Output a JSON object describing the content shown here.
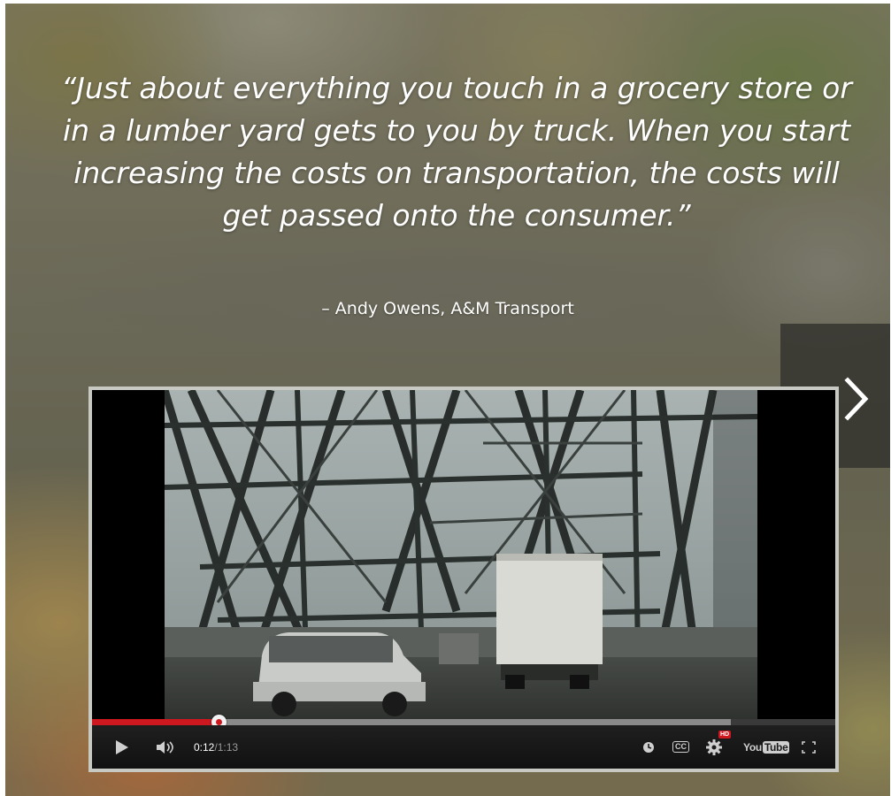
{
  "quote": {
    "text": "“Just about everything you touch in a grocery store or in a lumber yard gets to you by truck. When you start increasing the costs on transportation, the costs will get passed onto the consumer.”",
    "attribution": "– Andy Owens, A&M Transport"
  },
  "video": {
    "current_time": "0:12",
    "separator": " / ",
    "duration": "1:13",
    "progress_played": 0.17,
    "progress_loaded": 0.86,
    "logo_you": "You",
    "logo_tube": "Tube",
    "cc_label": "CC",
    "hd_badge": "HD"
  },
  "icons": {
    "next": "chevron-right-icon",
    "play": "play-icon",
    "volume": "volume-icon",
    "watch_later": "clock-icon",
    "captions": "cc-icon",
    "settings": "gear-icon",
    "fullscreen": "fullscreen-icon"
  },
  "colors": {
    "progress_red": "#cc181e",
    "controls_bg": "#1b1b1b",
    "frame_border": "#c9c9c4"
  }
}
